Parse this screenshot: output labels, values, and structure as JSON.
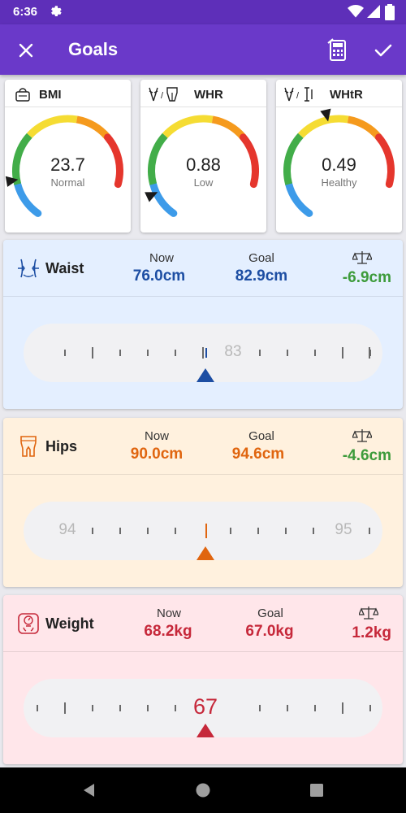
{
  "status_bar": {
    "time": "6:36"
  },
  "app_bar": {
    "title": "Goals"
  },
  "gauges": [
    {
      "label": "BMI",
      "value": "23.7",
      "status": "Normal",
      "indicator_fraction": 0.18
    },
    {
      "label": "WHR",
      "value": "0.88",
      "status": "Low",
      "indicator_fraction": 0.12
    },
    {
      "label": "WHtR",
      "value": "0.49",
      "status": "Healthy",
      "indicator_fraction": 0.53
    }
  ],
  "measurements": [
    {
      "name": "Waist",
      "now_label": "Now",
      "now": "76.0cm",
      "goal_label": "Goal",
      "goal": "82.9cm",
      "difference": "-6.9cm",
      "ruler_numbers": [
        "83"
      ],
      "bg": "#e4efff",
      "accent": "#1d4ea3",
      "diff_color": "#3d9b3b"
    },
    {
      "name": "Hips",
      "now_label": "Now",
      "now": "90.0cm",
      "goal_label": "Goal",
      "goal": "94.6cm",
      "difference": "-4.6cm",
      "ruler_numbers": [
        "94",
        "95"
      ],
      "bg": "#fff1de",
      "accent": "#e0650f",
      "diff_color": "#3d9b3b"
    },
    {
      "name": "Weight",
      "now_label": "Now",
      "now": "68.2kg",
      "goal_label": "Goal",
      "goal": "67.0kg",
      "difference": "1.2kg",
      "ruler_numbers": [
        "67"
      ],
      "bg": "#ffe6ea",
      "accent": "#c6283a",
      "diff_color": "#c6283a"
    }
  ],
  "colors": {
    "appbar": "#6a39c9",
    "statusbar": "#5e2fb9",
    "gauge_blue": "#3d9be9",
    "gauge_green": "#42ad49",
    "gauge_yellow": "#f5dc33",
    "gauge_orange": "#f59a1d",
    "gauge_red": "#e5362d"
  }
}
